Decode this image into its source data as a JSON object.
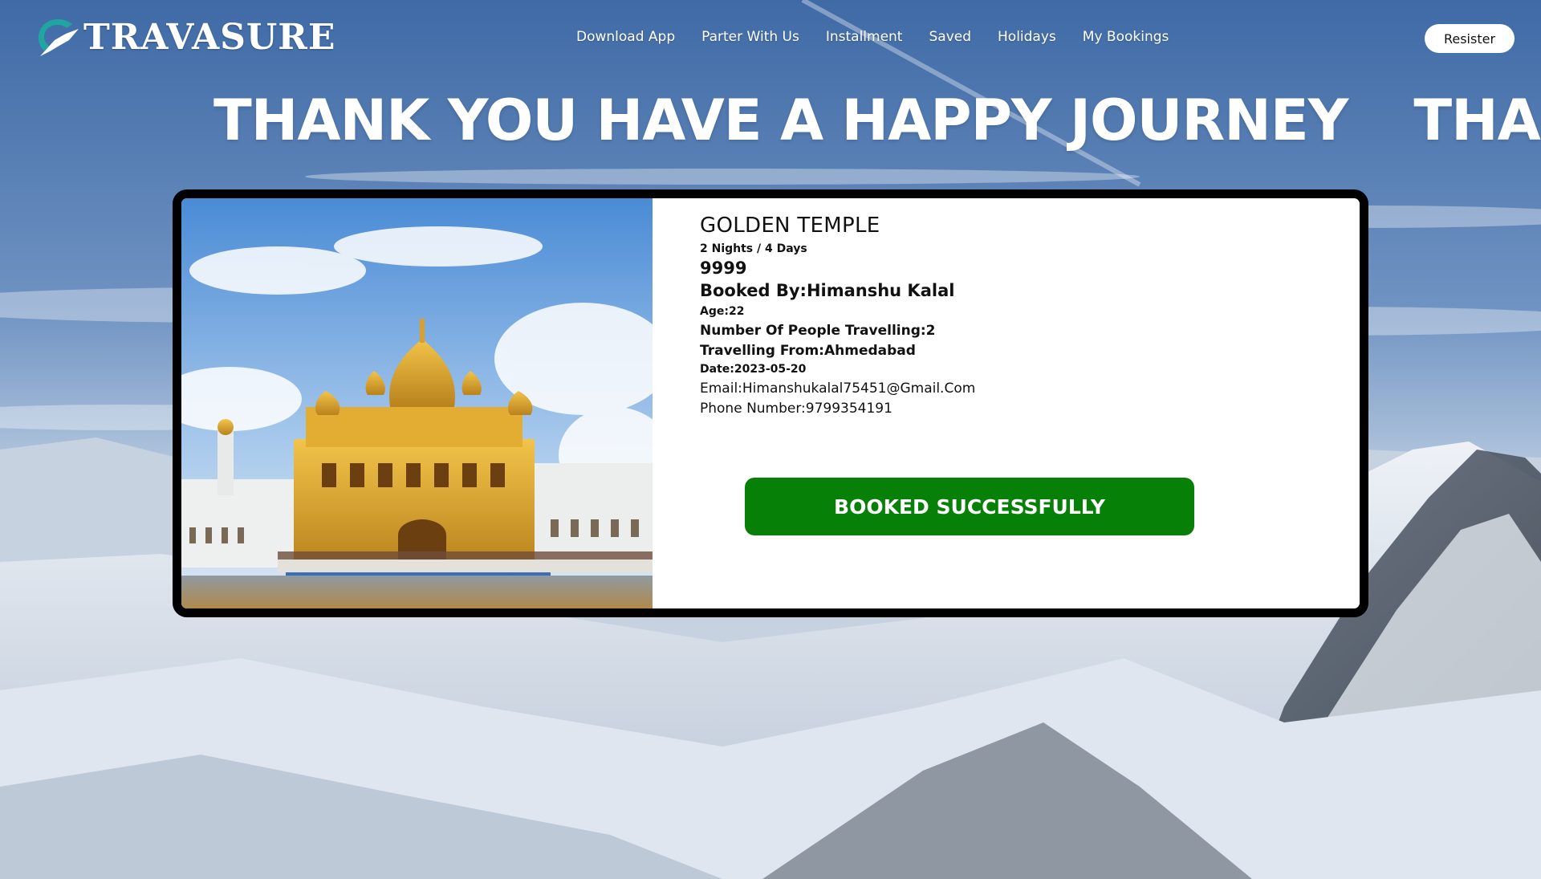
{
  "brand": {
    "name": "TRAVASURE",
    "logo_icon": "bird-logo-icon"
  },
  "nav": {
    "items": [
      "Download App",
      "Parter With Us",
      "Installment",
      "Saved",
      "Holidays",
      "My Bookings"
    ],
    "register_label": "Resister"
  },
  "marquee": {
    "text": "THANK YOU HAVE A HAPPY JOURNEY"
  },
  "booking": {
    "image_icon": "golden-temple-photo",
    "title": "GOLDEN TEMPLE",
    "duration": "2 Nights / 4 Days",
    "price": "9999",
    "booked_by": "Booked By:Himanshu Kalal",
    "age": "Age:22",
    "people": "Number Of People Travelling:2",
    "from": "Travelling From:Ahmedabad",
    "date": "Date:2023-05-20",
    "email": "Email:Himanshukalal75451@Gmail.Com",
    "phone": "Phone Number:9799354191",
    "status_label": "BOOKED SUCCESSFULLY",
    "status_color": "#078007"
  },
  "colors": {
    "sky": "#4f7ab3",
    "card_border": "#000000",
    "text": "#ffffff"
  }
}
